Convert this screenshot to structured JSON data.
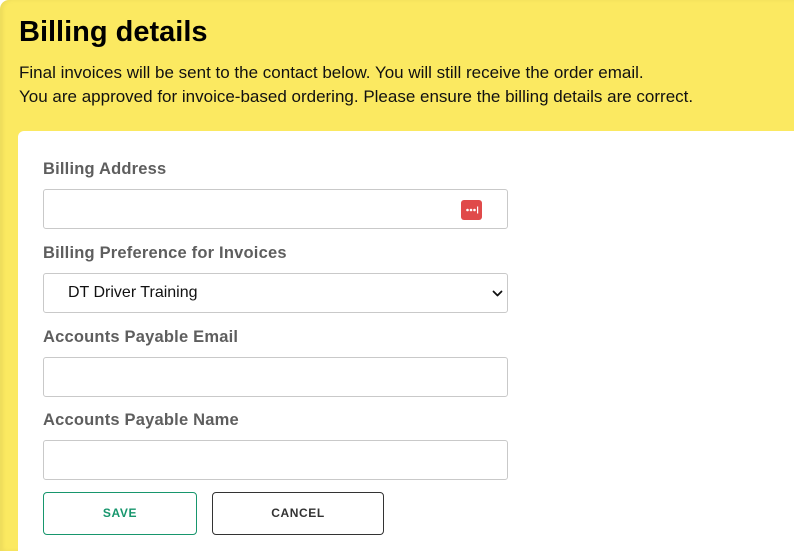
{
  "header": {
    "title": "Billing details",
    "line1": "Final invoices will be sent to the contact below. You will still receive the order email.",
    "line2": "You are approved for invoice-based ordering. Please ensure the billing details are correct."
  },
  "form": {
    "billing_address": {
      "label": "Billing Address",
      "value": "",
      "password_manager_icon": "password-manager-icon"
    },
    "billing_preference": {
      "label": "Billing Preference for Invoices",
      "selected": "DT Driver Training"
    },
    "ap_email": {
      "label": "Accounts Payable Email",
      "value": ""
    },
    "ap_name": {
      "label": "Accounts Payable Name",
      "value": ""
    }
  },
  "actions": {
    "save_label": "SAVE",
    "cancel_label": "CANCEL"
  },
  "colors": {
    "header_background": "#fbe961",
    "card_background": "#ffffff",
    "label_text": "#5e5e5e",
    "save_accent": "#17966d",
    "password_icon": "#e04a4a"
  }
}
